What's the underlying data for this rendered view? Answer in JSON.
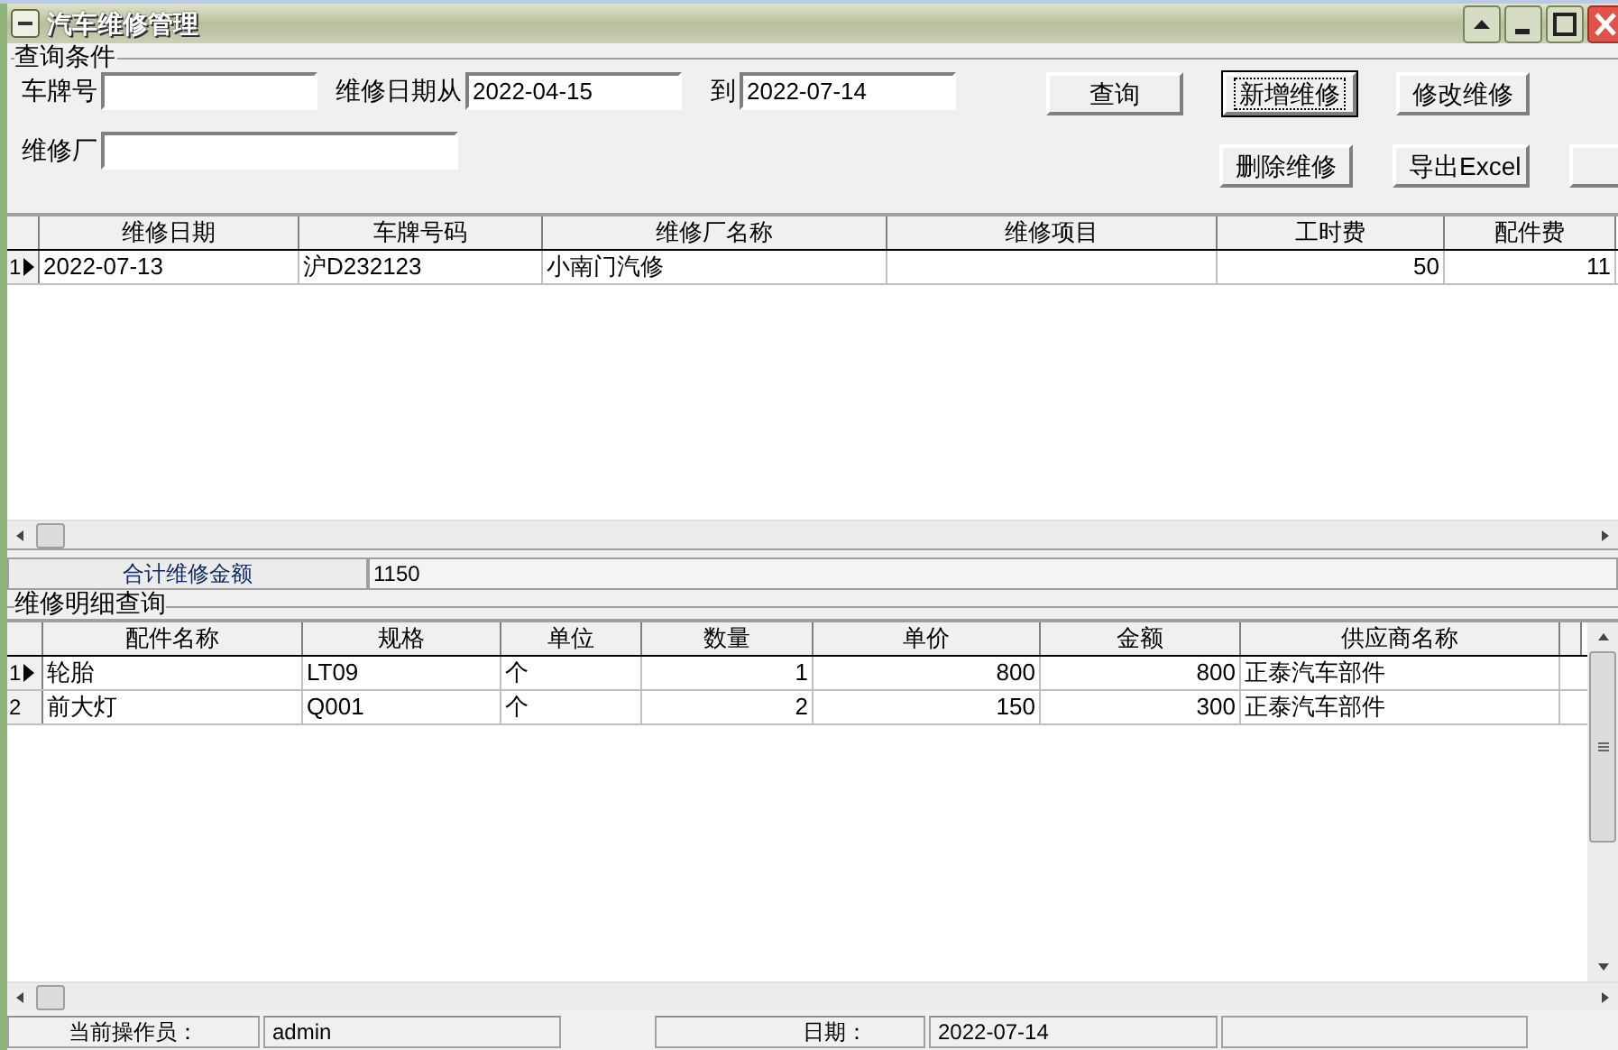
{
  "window": {
    "title": "汽车维修管理"
  },
  "query": {
    "group_label": "查询条件",
    "fields": [
      {
        "label": "车牌号"
      },
      {
        "label": "维修日期从",
        "value": "2022-04-15"
      },
      {
        "label": "到",
        "value": "2022-07-14"
      },
      {
        "label": "维修厂"
      }
    ],
    "buttons": [
      {
        "label": "查询",
        "focused": false
      },
      {
        "label": "新增维修",
        "focused": true
      },
      {
        "label": "修改维修",
        "focused": false
      },
      {
        "label": "删除维修",
        "focused": false
      },
      {
        "label": "导出Excel",
        "focused": false
      }
    ]
  },
  "repairs_table": {
    "columns": [
      {
        "label": "维修日期",
        "kind": "text"
      },
      {
        "label": "车牌号码",
        "kind": "text"
      },
      {
        "label": "维修厂名称",
        "kind": "text"
      },
      {
        "label": "维修项目",
        "kind": "text"
      },
      {
        "label": "工时费",
        "kind": "number"
      },
      {
        "label": "配件费",
        "kind": "number"
      }
    ],
    "rows": [
      {
        "number": "1",
        "selected": true,
        "cells": [
          "2022-07-13",
          "沪D232123",
          "小南门汽修",
          null,
          "50",
          "11"
        ]
      }
    ]
  },
  "summary": {
    "label": "合计维修金额",
    "value": "1150"
  },
  "detail": {
    "group_label": "维修明细查询",
    "columns": [
      {
        "label": "配件名称",
        "kind": "text"
      },
      {
        "label": "规格",
        "kind": "text"
      },
      {
        "label": "单位",
        "kind": "text"
      },
      {
        "label": "数量",
        "kind": "number"
      },
      {
        "label": "单价",
        "kind": "number"
      },
      {
        "label": "金额",
        "kind": "number"
      },
      {
        "label": "供应商名称",
        "kind": "text"
      }
    ],
    "rows": [
      {
        "number": "1",
        "selected": true,
        "cells": [
          "轮胎",
          "LT09",
          "个",
          "1",
          "800",
          "800",
          "正泰汽车部件"
        ]
      },
      {
        "number": "2",
        "selected": false,
        "cells": [
          "前大灯",
          "Q001",
          "个",
          "2",
          "150",
          "300",
          "正泰汽车部件"
        ]
      }
    ]
  },
  "status_bar": [
    "当前操作员：",
    "admin",
    "日期：",
    "2022-07-14"
  ]
}
